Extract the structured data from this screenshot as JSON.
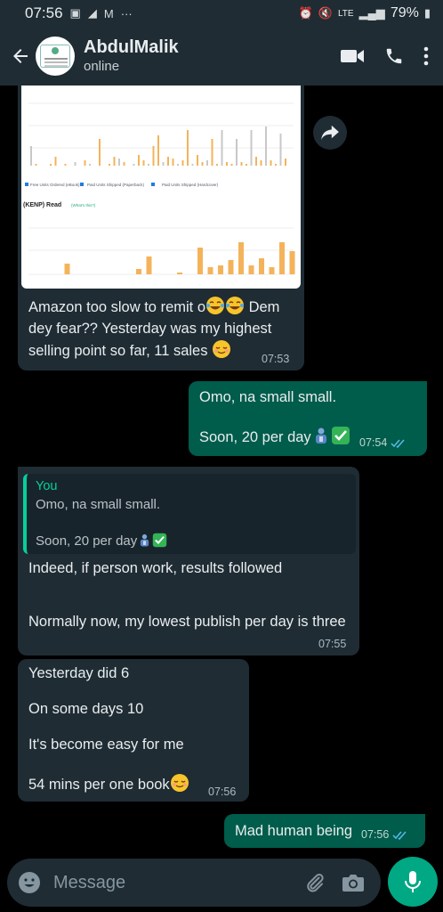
{
  "status_bar": {
    "time": "07:56",
    "network": "LTE",
    "battery": "79%"
  },
  "header": {
    "contact_name": "AbdulMalik",
    "contact_status": "online"
  },
  "chart_image": {
    "legend": [
      "Free Units Ordered (eBook)",
      "Paid Units Shipped (Paperback)",
      "Paid Units Shipped (Hardcover)"
    ],
    "section_title": "(KENP) Read",
    "section_link": "(What's this?)"
  },
  "messages": [
    {
      "direction": "in",
      "text_lines": [
        "Amazon too slow to remit o",
        " Dem",
        "dey fear?? Yesterday was my highest",
        "selling point so far, 11 sales"
      ],
      "time": "07:53"
    },
    {
      "direction": "out",
      "text_lines": [
        "Omo, na small small.",
        "Soon, 20 per day"
      ],
      "time": "07:54"
    },
    {
      "direction": "in",
      "quote_author": "You",
      "quote_lines": [
        "Omo, na small small.",
        "Soon, 20 per day"
      ],
      "text_lines": [
        "Indeed, if person work, results followed",
        "Normally now, my lowest publish per day is three"
      ],
      "time": "07:55"
    },
    {
      "direction": "in",
      "text_lines": [
        "Yesterday did 6",
        "On some days 10",
        "It's become easy for me",
        "54 mins per one book"
      ],
      "time": "07:56"
    },
    {
      "direction": "out",
      "text_lines": [
        "Mad human being"
      ],
      "time": "07:56"
    }
  ],
  "composer": {
    "placeholder": "Message"
  },
  "colors": {
    "header_bg": "#1f2c34",
    "incoming_bg": "#1f2c34",
    "outgoing_bg": "#005c4b",
    "accent": "#00a884",
    "read_ticks": "#53bdeb"
  }
}
